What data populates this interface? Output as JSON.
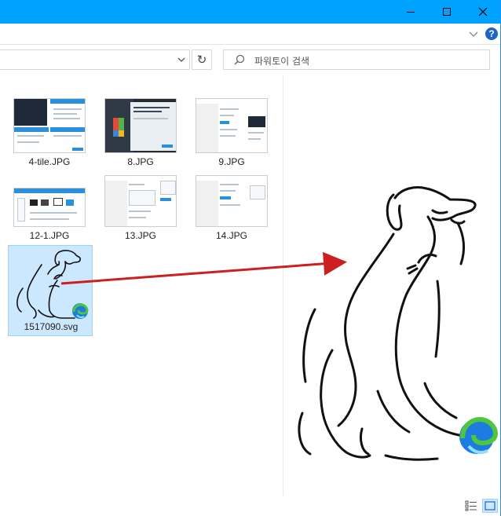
{
  "window": {
    "min_icon": "minimize-icon",
    "max_icon": "maximize-icon",
    "close_icon": "close-icon",
    "close_glyph": "✕"
  },
  "ribbon": {
    "expand_icon": "chevron-down-icon",
    "help_label": "?"
  },
  "address": {
    "value": "",
    "refresh_glyph": "↻"
  },
  "search": {
    "placeholder": "파워토이 검색"
  },
  "files": [
    {
      "name": "4-tile.JPG"
    },
    {
      "name": "8.JPG"
    },
    {
      "name": "9.JPG"
    },
    {
      "name": "12-1.JPG"
    },
    {
      "name": "13.JPG"
    },
    {
      "name": "14.JPG"
    },
    {
      "name": "1517090.svg",
      "selected": true
    }
  ],
  "annotation": {
    "arrow_color": "#cc1f1f"
  },
  "colors": {
    "titlebar": "#00a2ff",
    "selection": "#cce8ff",
    "edge_blue": "#1e7be0",
    "edge_green": "#4fc63e"
  }
}
